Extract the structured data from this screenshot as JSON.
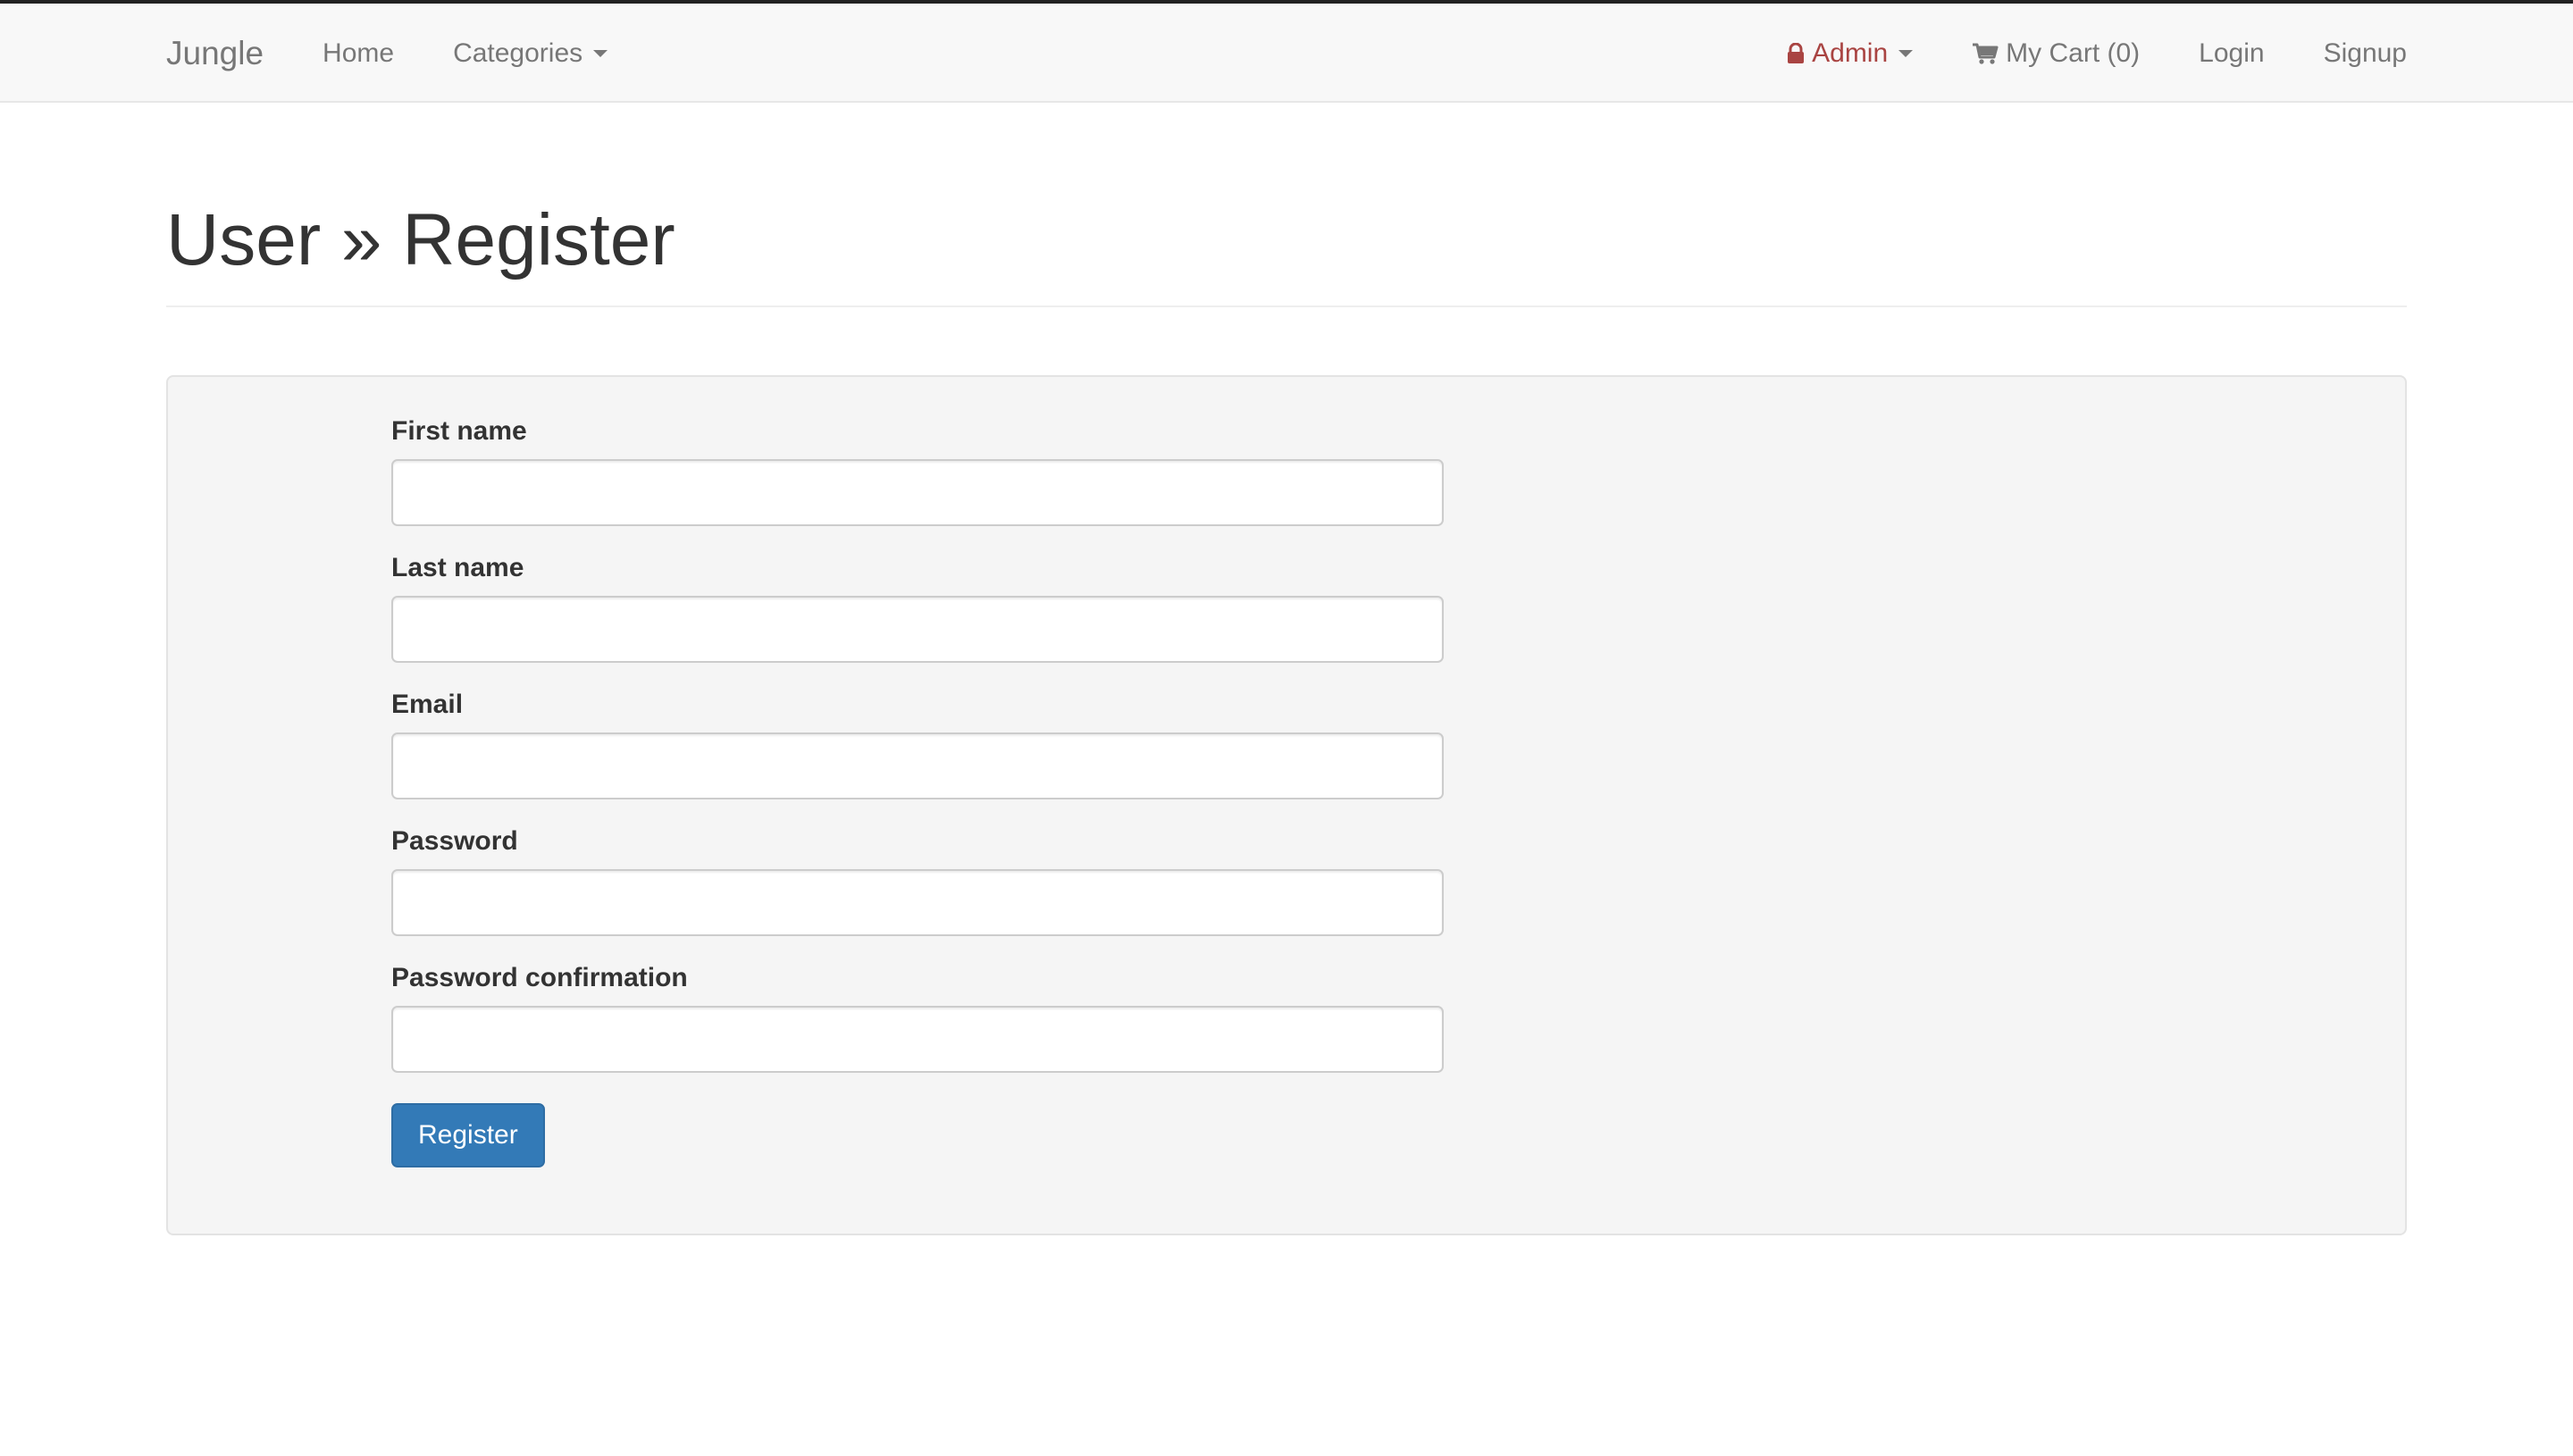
{
  "nav": {
    "brand": "Jungle",
    "left_links": [
      "Home",
      "Categories"
    ],
    "admin_label": "Admin",
    "cart_label": "My Cart (0)",
    "login_label": "Login",
    "signup_label": "Signup",
    "icons": {
      "admin": "lock-icon",
      "cart": "shopping-cart-icon",
      "dropdown": "caret-down-icon"
    }
  },
  "page": {
    "title": "User » Register"
  },
  "form": {
    "fields": [
      {
        "label": "First name",
        "value": ""
      },
      {
        "label": "Last name",
        "value": ""
      },
      {
        "label": "Email",
        "value": ""
      },
      {
        "label": "Password",
        "value": ""
      },
      {
        "label": "Password confirmation",
        "value": ""
      }
    ],
    "submit_label": "Register"
  },
  "colors": {
    "navbar_bg": "#f8f8f8",
    "admin_text": "#a94442",
    "primary_button": "#337ab7",
    "well_bg": "#f5f5f5"
  }
}
